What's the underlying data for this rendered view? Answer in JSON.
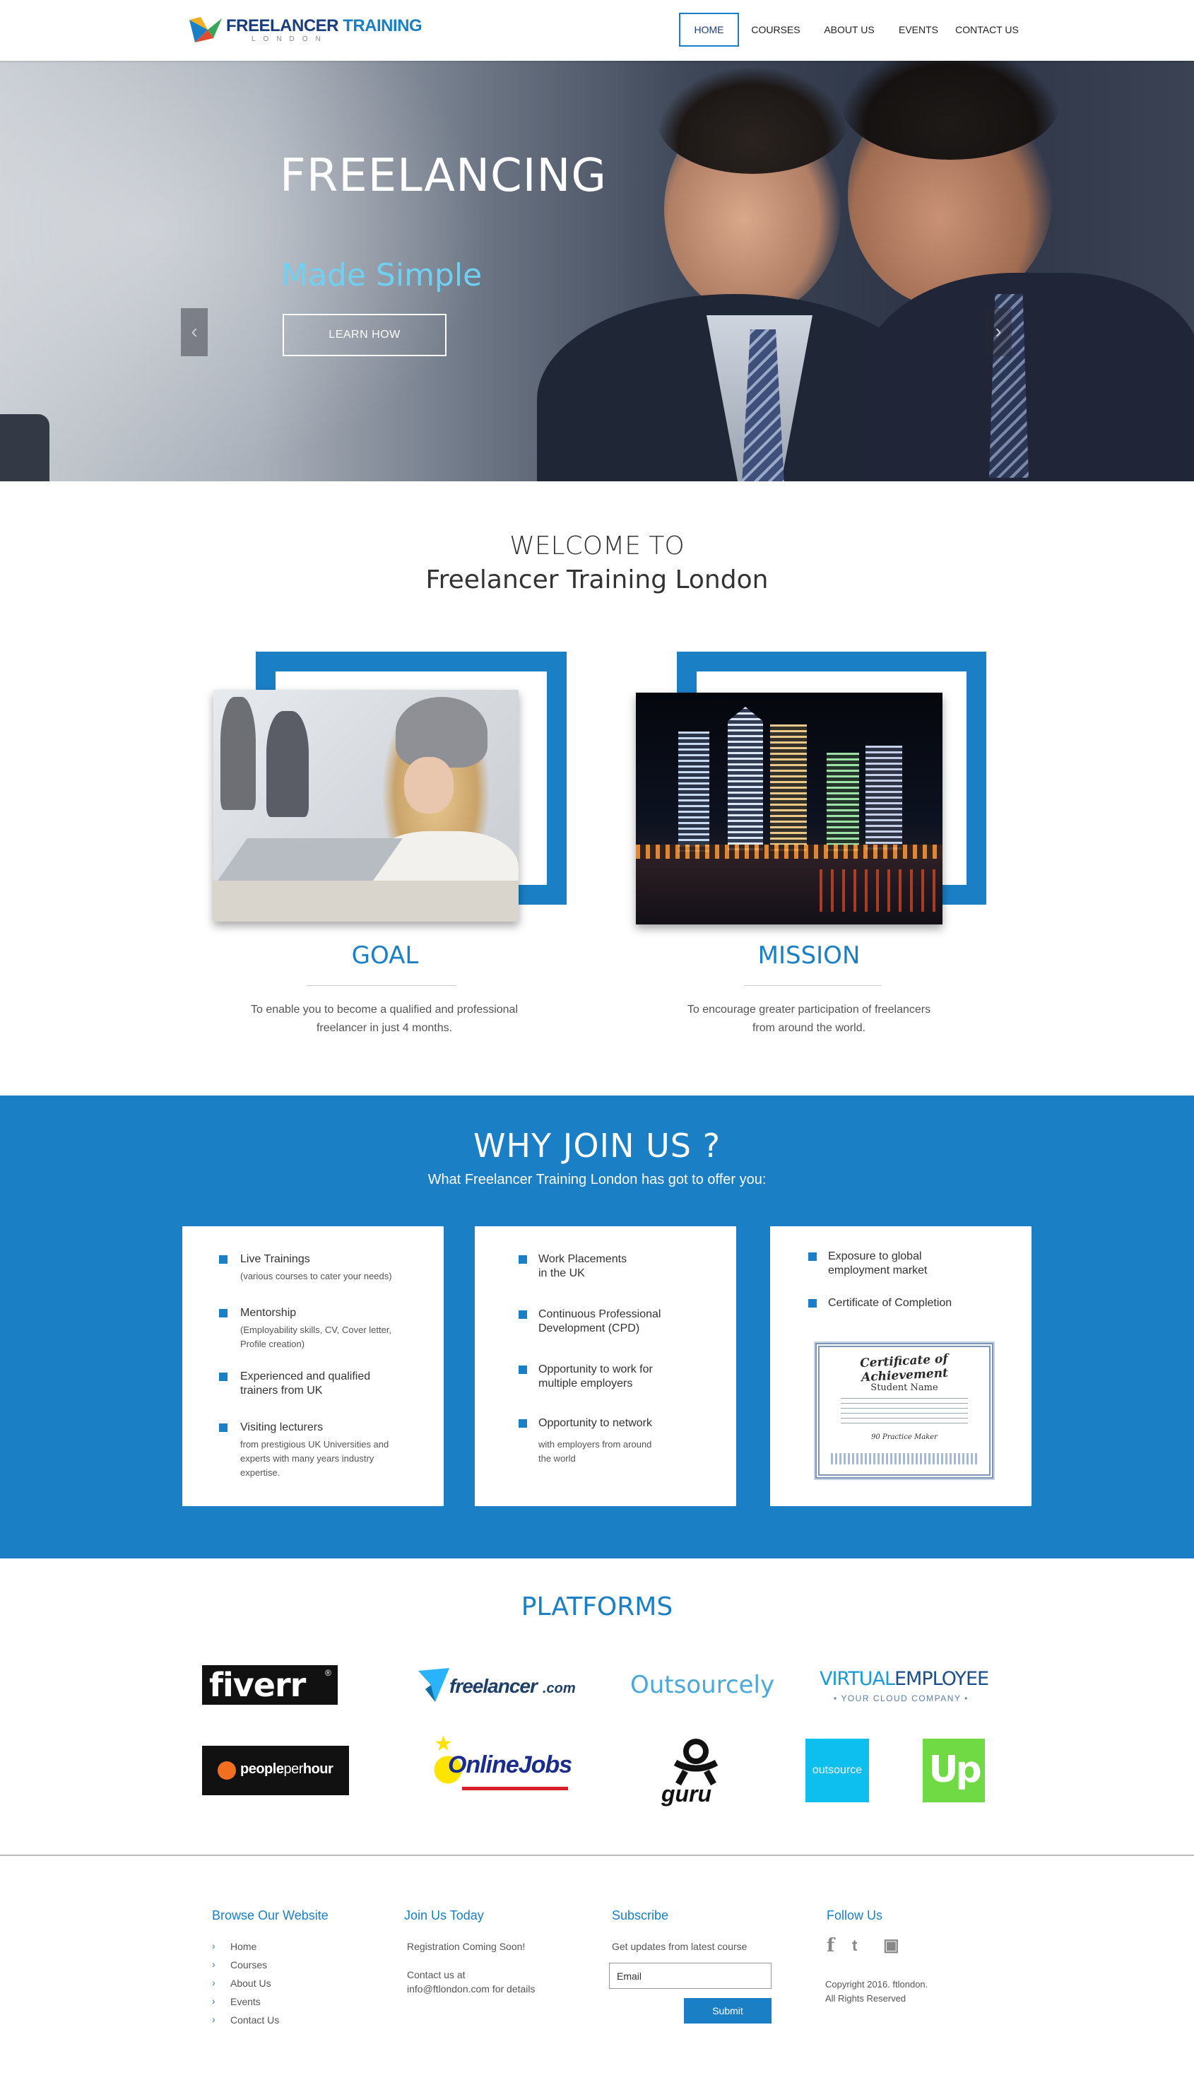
{
  "header": {
    "logo_text_a": "FREELANCER",
    "logo_text_b": "TRAINING",
    "logo_sub": "LONDON",
    "nav": [
      "HOME",
      "COURSES",
      "ABOUT US",
      "EVENTS",
      "CONTACT US"
    ]
  },
  "hero": {
    "title": "FREELANCING",
    "subtitle": "Made Simple",
    "button": "LEARN HOW",
    "prev_glyph": "‹",
    "next_glyph": "›"
  },
  "welcome": {
    "line1": "WELCOME TO",
    "line2": "Freelancer Training London"
  },
  "goal": {
    "title": "GOAL",
    "text_1": "To enable you to become a qualified and professional",
    "text_2": "freelancer in just 4 months."
  },
  "mission": {
    "title": "MISSION",
    "text_1": "To encourage greater participation of freelancers",
    "text_2": "from around the world."
  },
  "why": {
    "title": "WHY JOIN US ?",
    "subtitle": "What Freelancer Training London has got to offer you:",
    "card1": [
      {
        "title": "Live Trainings",
        "desc": "(various courses to cater your needs)"
      },
      {
        "title": "Mentorship",
        "desc_1": "(Employability skills, CV, Cover letter,",
        "desc_2": "Profile creation)"
      },
      {
        "title_1": "Experienced and qualified",
        "title_2": "trainers from UK"
      },
      {
        "title": "Visiting lecturers",
        "desc_1": "from prestigious UK Universities and",
        "desc_2": "experts with many years industry",
        "desc_3": "expertise."
      }
    ],
    "card2": [
      {
        "title_1": "Work Placements",
        "title_2": "in the UK"
      },
      {
        "title_1": "Continuous Professional",
        "title_2": "Development (CPD)"
      },
      {
        "title_1": "Opportunity to work for",
        "title_2": "multiple employers"
      },
      {
        "title": "Opportunity to network",
        "desc_1": "with employers from around",
        "desc_2": "the world"
      }
    ],
    "card3": [
      {
        "title_1": "Exposure to global",
        "title_2": "employment market"
      },
      {
        "title": "Certificate of Completion"
      }
    ],
    "certificate": {
      "heading": "Certificate of Achievement",
      "name": "Student Name",
      "signature": "90 Practice Maker"
    }
  },
  "platforms": {
    "title": "PLATFORMS",
    "fiverr": "fiverr",
    "fiverr_mark": "®",
    "freelancer": "freelancer",
    "freelancer_com": ".com",
    "outsourcely": "Outsourcely",
    "virtual_a": "VIRTUAL",
    "virtual_b": "EMPLOYEE",
    "virtual_sub": "• YOUR CLOUD COMPANY •",
    "pph_a": "people",
    "pph_b": "per",
    "pph_c": "hour",
    "onlinejobs_a": "O",
    "onlinejobs_b": "nlineJobs",
    "guru": "guru",
    "outsource": "outsource",
    "upwork": "Up"
  },
  "footer": {
    "browse": {
      "heading": "Browse Our Website",
      "links": [
        "Home",
        "Courses",
        "About Us",
        "Events",
        "Contact Us"
      ]
    },
    "join": {
      "heading": "Join Us Today",
      "line1": "Registration Coming Soon!",
      "line2": "Contact us at",
      "line3": "info@ftlondon.com for details"
    },
    "subscribe": {
      "heading": "Subscribe",
      "text": "Get updates from latest course",
      "email_value": "Email",
      "submit": "Submit"
    },
    "follow": {
      "heading": "Follow Us",
      "icons": [
        "f",
        "t",
        "▣"
      ],
      "copyright_1": "Copyright 2016. ftlondon.",
      "copyright_2": "All Rights Reserved"
    }
  },
  "colors": {
    "brand_blue": "#1a7fc4",
    "hero_accent": "#6fd0f2",
    "navy": "#1a3d7c"
  }
}
